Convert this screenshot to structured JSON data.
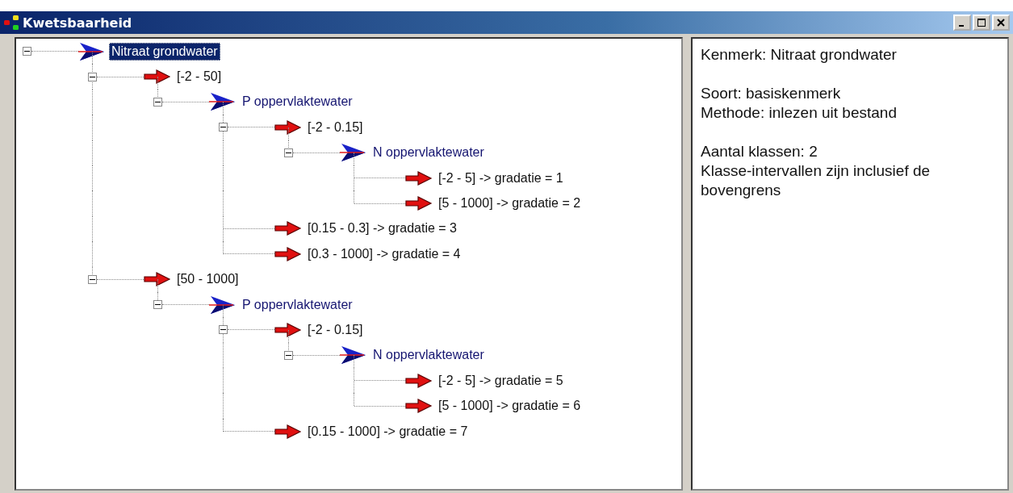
{
  "window": {
    "title": "Kwetsbaarheid"
  },
  "tree": [
    {
      "label": "Nitraat grondwater",
      "kind": "criterion",
      "selected": true,
      "expanded": true,
      "children": [
        {
          "label": "[-2 - 50]",
          "kind": "interval",
          "selected": false,
          "expanded": true,
          "children": [
            {
              "label": "P oppervlaktewater",
              "kind": "criterion",
              "selected": false,
              "expanded": true,
              "children": [
                {
                  "label": "[-2 - 0.15]",
                  "kind": "interval",
                  "selected": false,
                  "expanded": true,
                  "children": [
                    {
                      "label": "N oppervlaktewater",
                      "kind": "criterion",
                      "selected": false,
                      "expanded": true,
                      "children": [
                        {
                          "label": "[-2 - 5] -> gradatie = 1",
                          "kind": "interval",
                          "selected": false
                        },
                        {
                          "label": "[5 - 1000] -> gradatie = 2",
                          "kind": "interval",
                          "selected": false
                        }
                      ]
                    }
                  ]
                },
                {
                  "label": "[0.15 - 0.3] -> gradatie = 3",
                  "kind": "interval",
                  "selected": false
                },
                {
                  "label": "[0.3 - 1000] -> gradatie = 4",
                  "kind": "interval",
                  "selected": false
                }
              ]
            }
          ]
        },
        {
          "label": "[50 - 1000]",
          "kind": "interval",
          "selected": false,
          "expanded": true,
          "children": [
            {
              "label": "P oppervlaktewater",
              "kind": "criterion",
              "selected": false,
              "expanded": true,
              "children": [
                {
                  "label": "[-2 - 0.15]",
                  "kind": "interval",
                  "selected": false,
                  "expanded": true,
                  "children": [
                    {
                      "label": "N oppervlaktewater",
                      "kind": "criterion",
                      "selected": false,
                      "expanded": true,
                      "children": [
                        {
                          "label": "[-2 - 5] -> gradatie = 5",
                          "kind": "interval",
                          "selected": false
                        },
                        {
                          "label": "[5 - 1000] -> gradatie = 6",
                          "kind": "interval",
                          "selected": false
                        }
                      ]
                    }
                  ]
                },
                {
                  "label": "[0.15 - 1000] -> gradatie = 7",
                  "kind": "interval",
                  "selected": false
                }
              ]
            }
          ]
        }
      ]
    }
  ],
  "info": [
    {
      "lines": [
        "Kenmerk: Nitraat grondwater"
      ]
    },
    {
      "lines": [
        "Soort: basiskenmerk",
        "Methode: inlezen uit bestand"
      ]
    },
    {
      "lines": [
        "Aantal klassen: 2",
        "Klasse-intervallen zijn inclusief de bovengrens"
      ]
    }
  ]
}
